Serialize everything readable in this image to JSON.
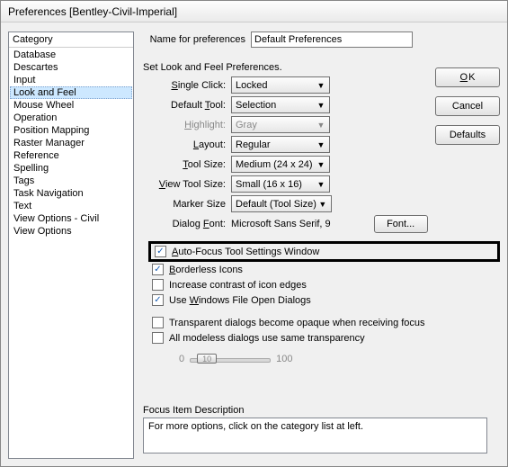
{
  "window_title": "Preferences [Bentley-Civil-Imperial]",
  "category_header": "Category",
  "categories": [
    "Database",
    "Descartes",
    "Input",
    "Look and Feel",
    "Mouse Wheel",
    "Operation",
    "Position Mapping",
    "Raster Manager",
    "Reference",
    "Spelling",
    "Tags",
    "Task Navigation",
    "Text",
    "View Options - Civil",
    "View Options"
  ],
  "selected_category_index": 3,
  "name_label": "Name for preferences",
  "name_value": "Default Preferences",
  "section_label": "Set Look and Feel Preferences.",
  "rows": {
    "single_click": {
      "label": "Single Click:",
      "accel": "S",
      "value": "Locked"
    },
    "default_tool": {
      "label": "Default Tool:",
      "accel": "T",
      "value": "Selection"
    },
    "highlight": {
      "label": "Highlight:",
      "accel": "H",
      "value": "Gray",
      "disabled": true
    },
    "layout": {
      "label": "Layout:",
      "accel": "L",
      "value": "Regular"
    },
    "tool_size": {
      "label": "Tool Size:",
      "accel": "T",
      "value": "Medium (24 x 24)"
    },
    "view_tool_size": {
      "label": "View Tool Size:",
      "accel": "V",
      "value": "Small (16 x 16)"
    },
    "marker_size": {
      "label": "Marker Size",
      "value": "Default (Tool Size)"
    },
    "dialog_font": {
      "label": "Dialog Font:",
      "accel": "F",
      "value": "Microsoft Sans Serif, 9"
    }
  },
  "font_button": "Font...",
  "checkboxes": {
    "auto_focus": {
      "label": "Auto-Focus Tool Settings Window",
      "accel": "A",
      "checked": true
    },
    "borderless": {
      "label": "Borderless Icons",
      "accel": "B",
      "checked": true
    },
    "contrast": {
      "label": "Increase contrast of icon edges",
      "checked": false
    },
    "file_dialogs": {
      "label": "Use Windows File Open Dialogs",
      "accel": "W",
      "checked": true
    },
    "transparent": {
      "label": "Transparent dialogs become opaque when receiving focus",
      "checked": false
    },
    "modeless": {
      "label": "All modeless dialogs use same transparency",
      "checked": false
    }
  },
  "slider": {
    "min": "0",
    "max": "100",
    "value": "10"
  },
  "buttons": {
    "ok": "OK",
    "cancel": "Cancel",
    "defaults": "Defaults"
  },
  "focus_label": "Focus Item Description",
  "focus_text": "For more options, click on the category list at left."
}
